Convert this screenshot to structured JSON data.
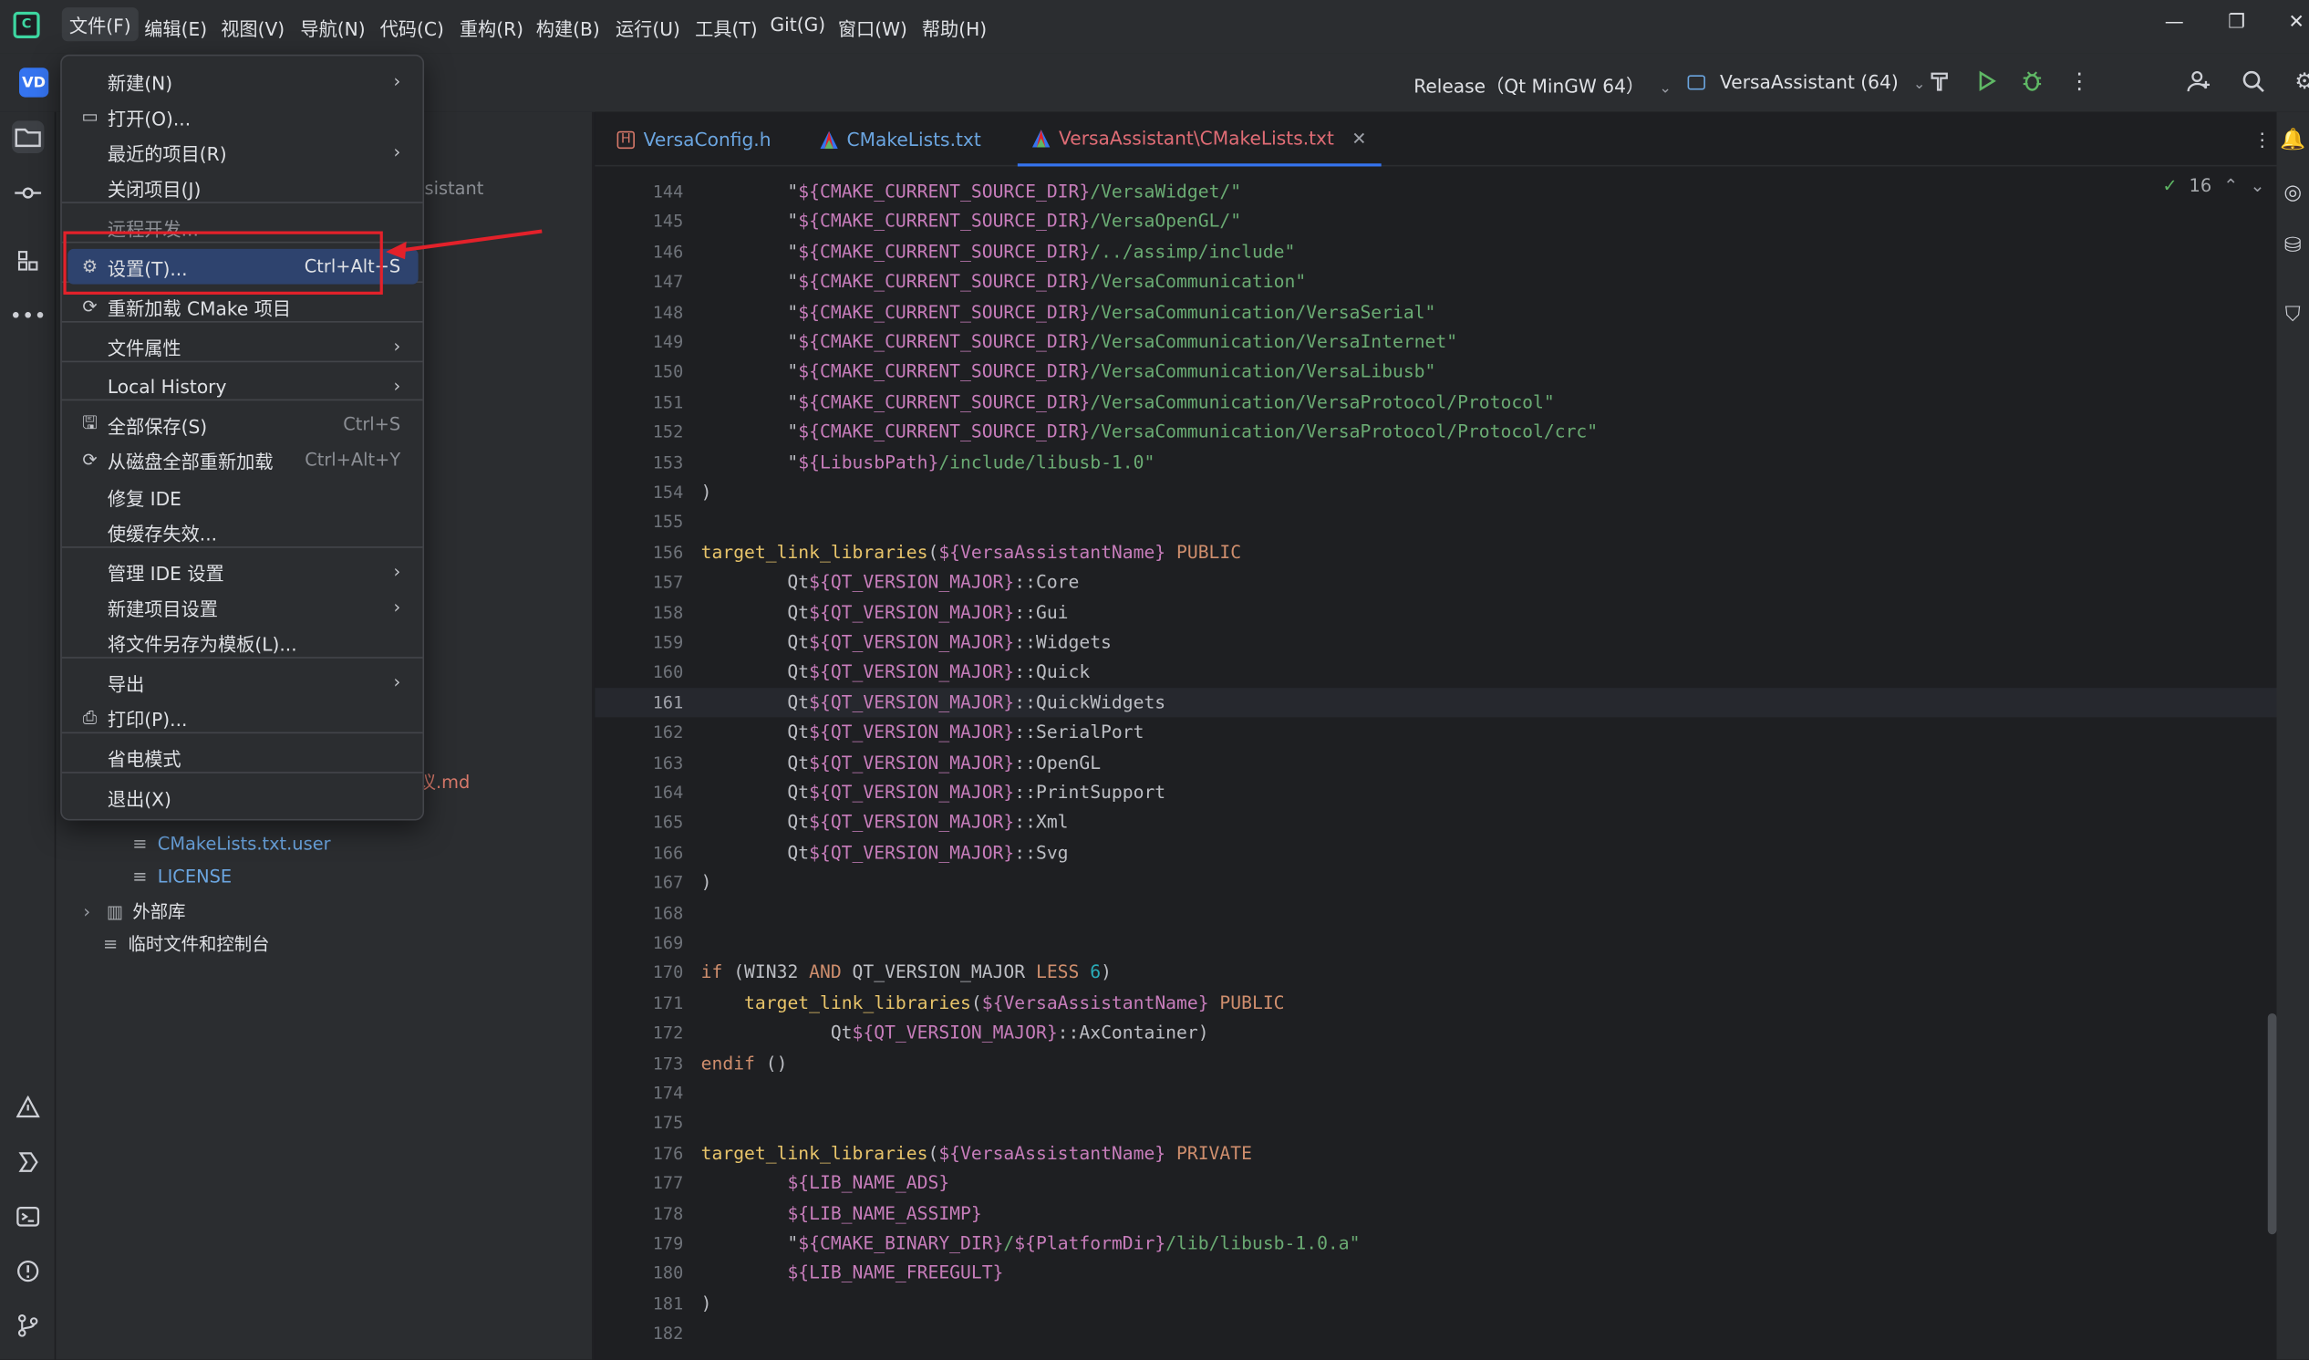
{
  "menubar": {
    "items": [
      "文件(F)",
      "编辑(E)",
      "视图(V)",
      "导航(N)",
      "代码(C)",
      "重构(R)",
      "构建(B)",
      "运行(U)",
      "工具(T)",
      "Git(G)",
      "窗口(W)",
      "帮助(H)"
    ]
  },
  "toolbar": {
    "project_badge": "VD",
    "run_config": "Release（Qt MinGW 64）",
    "target": "VersaAssistant (64)"
  },
  "file_menu": {
    "items": [
      {
        "label": "新建(N)",
        "shortcut": "",
        "submenu": true,
        "icon": ""
      },
      {
        "label": "打开(O)...",
        "shortcut": "",
        "submenu": false,
        "icon": "folder-icon"
      },
      {
        "label": "最近的项目(R)",
        "shortcut": "",
        "submenu": true,
        "icon": ""
      },
      {
        "label": "关闭项目(J)",
        "shortcut": "",
        "submenu": false,
        "icon": ""
      },
      {
        "label": "远程开发...",
        "shortcut": "",
        "submenu": false,
        "icon": ""
      },
      {
        "label": "设置(T)...",
        "shortcut": "Ctrl+Alt+S",
        "submenu": false,
        "icon": "gear-icon"
      },
      {
        "label": "重新加载 CMake 项目",
        "shortcut": "",
        "submenu": false,
        "icon": "reload-icon"
      },
      {
        "label": "文件属性",
        "shortcut": "",
        "submenu": true,
        "icon": ""
      },
      {
        "label": "Local History",
        "shortcut": "",
        "submenu": true,
        "icon": ""
      },
      {
        "label": "全部保存(S)",
        "shortcut": "Ctrl+S",
        "submenu": false,
        "icon": "save-icon"
      },
      {
        "label": "从磁盘全部重新加载",
        "shortcut": "Ctrl+Alt+Y",
        "submenu": false,
        "icon": "reload-icon"
      },
      {
        "label": "修复 IDE",
        "shortcut": "",
        "submenu": false,
        "icon": ""
      },
      {
        "label": "使缓存失效...",
        "shortcut": "",
        "submenu": false,
        "icon": ""
      },
      {
        "label": "管理 IDE 设置",
        "shortcut": "",
        "submenu": true,
        "icon": ""
      },
      {
        "label": "新建项目设置",
        "shortcut": "",
        "submenu": true,
        "icon": ""
      },
      {
        "label": "将文件另存为模板(L)...",
        "shortcut": "",
        "submenu": false,
        "icon": ""
      },
      {
        "label": "导出",
        "shortcut": "",
        "submenu": true,
        "icon": ""
      },
      {
        "label": "打印(P)...",
        "shortcut": "",
        "submenu": false,
        "icon": "print-icon"
      },
      {
        "label": "省电模式",
        "shortcut": "",
        "submenu": false,
        "icon": ""
      },
      {
        "label": "退出(X)",
        "shortcut": "",
        "submenu": false,
        "icon": ""
      }
    ]
  },
  "project_tree": {
    "partial_texts": [
      "ssistant",
      "议.md"
    ],
    "items": [
      {
        "label": "CMakeLists.txt.user",
        "kind": "file"
      },
      {
        "label": "LICENSE",
        "kind": "file"
      },
      {
        "label": "外部库",
        "kind": "folder"
      },
      {
        "label": "临时文件和控制台",
        "kind": "scratch"
      }
    ]
  },
  "tabs": [
    {
      "label": "VersaConfig.h",
      "icon": "header-file-icon",
      "active": false
    },
    {
      "label": "CMakeLists.txt",
      "icon": "cmake-icon",
      "active": false
    },
    {
      "label": "VersaAssistant\\CMakeLists.txt",
      "icon": "cmake-icon",
      "active": true
    }
  ],
  "inspection": {
    "count": "16"
  },
  "editor": {
    "current_line": 161,
    "lines": [
      {
        "n": 144,
        "tokens": [
          [
            "p",
            "        \""
          ],
          [
            "var",
            "${CMAKE_CURRENT_SOURCE_DIR}"
          ],
          [
            "str",
            "/VersaWidget/\""
          ]
        ]
      },
      {
        "n": 145,
        "tokens": [
          [
            "p",
            "        \""
          ],
          [
            "var",
            "${CMAKE_CURRENT_SOURCE_DIR}"
          ],
          [
            "str",
            "/VersaOpenGL/\""
          ]
        ]
      },
      {
        "n": 146,
        "tokens": [
          [
            "p",
            "        \""
          ],
          [
            "var",
            "${CMAKE_CURRENT_SOURCE_DIR}"
          ],
          [
            "str",
            "/../assimp/include\""
          ]
        ]
      },
      {
        "n": 147,
        "tokens": [
          [
            "p",
            "        \""
          ],
          [
            "var",
            "${CMAKE_CURRENT_SOURCE_DIR}"
          ],
          [
            "str",
            "/VersaCommunication\""
          ]
        ]
      },
      {
        "n": 148,
        "tokens": [
          [
            "p",
            "        \""
          ],
          [
            "var",
            "${CMAKE_CURRENT_SOURCE_DIR}"
          ],
          [
            "str",
            "/VersaCommunication/VersaSerial\""
          ]
        ]
      },
      {
        "n": 149,
        "tokens": [
          [
            "p",
            "        \""
          ],
          [
            "var",
            "${CMAKE_CURRENT_SOURCE_DIR}"
          ],
          [
            "str",
            "/VersaCommunication/VersaInternet\""
          ]
        ]
      },
      {
        "n": 150,
        "tokens": [
          [
            "p",
            "        \""
          ],
          [
            "var",
            "${CMAKE_CURRENT_SOURCE_DIR}"
          ],
          [
            "str",
            "/VersaCommunication/VersaLibusb\""
          ]
        ]
      },
      {
        "n": 151,
        "tokens": [
          [
            "p",
            "        \""
          ],
          [
            "var",
            "${CMAKE_CURRENT_SOURCE_DIR}"
          ],
          [
            "str",
            "/VersaCommunication/VersaProtocol/Protocol\""
          ]
        ]
      },
      {
        "n": 152,
        "tokens": [
          [
            "p",
            "        \""
          ],
          [
            "var",
            "${CMAKE_CURRENT_SOURCE_DIR}"
          ],
          [
            "str",
            "/VersaCommunication/VersaProtocol/Protocol/crc\""
          ]
        ]
      },
      {
        "n": 153,
        "tokens": [
          [
            "p",
            "        \""
          ],
          [
            "var",
            "${LibusbPath}"
          ],
          [
            "str",
            "/include/libusb-1.0\""
          ]
        ]
      },
      {
        "n": 154,
        "tokens": [
          [
            "p",
            ")"
          ]
        ]
      },
      {
        "n": 155,
        "tokens": []
      },
      {
        "n": 156,
        "tokens": [
          [
            "fn",
            "target_link_libraries"
          ],
          [
            "p",
            "("
          ],
          [
            "var",
            "${VersaAssistantName}"
          ],
          [
            "kw",
            " PUBLIC"
          ]
        ]
      },
      {
        "n": 157,
        "tokens": [
          [
            "p",
            "        Qt"
          ],
          [
            "var",
            "${QT_VERSION_MAJOR}"
          ],
          [
            "p",
            "::Core"
          ]
        ]
      },
      {
        "n": 158,
        "tokens": [
          [
            "p",
            "        Qt"
          ],
          [
            "var",
            "${QT_VERSION_MAJOR}"
          ],
          [
            "p",
            "::Gui"
          ]
        ]
      },
      {
        "n": 159,
        "tokens": [
          [
            "p",
            "        Qt"
          ],
          [
            "var",
            "${QT_VERSION_MAJOR}"
          ],
          [
            "p",
            "::Widgets"
          ]
        ]
      },
      {
        "n": 160,
        "tokens": [
          [
            "p",
            "        Qt"
          ],
          [
            "var",
            "${QT_VERSION_MAJOR}"
          ],
          [
            "p",
            "::Quick"
          ]
        ]
      },
      {
        "n": 161,
        "tokens": [
          [
            "p",
            "        Qt"
          ],
          [
            "var",
            "${QT_VERSION_MAJOR}"
          ],
          [
            "p",
            "::QuickWidgets"
          ]
        ]
      },
      {
        "n": 162,
        "tokens": [
          [
            "p",
            "        Qt"
          ],
          [
            "var",
            "${QT_VERSION_MAJOR}"
          ],
          [
            "p",
            "::SerialPort"
          ]
        ]
      },
      {
        "n": 163,
        "tokens": [
          [
            "p",
            "        Qt"
          ],
          [
            "var",
            "${QT_VERSION_MAJOR}"
          ],
          [
            "p",
            "::OpenGL"
          ]
        ]
      },
      {
        "n": 164,
        "tokens": [
          [
            "p",
            "        Qt"
          ],
          [
            "var",
            "${QT_VERSION_MAJOR}"
          ],
          [
            "p",
            "::PrintSupport"
          ]
        ]
      },
      {
        "n": 165,
        "tokens": [
          [
            "p",
            "        Qt"
          ],
          [
            "var",
            "${QT_VERSION_MAJOR}"
          ],
          [
            "p",
            "::Xml"
          ]
        ]
      },
      {
        "n": 166,
        "tokens": [
          [
            "p",
            "        Qt"
          ],
          [
            "var",
            "${QT_VERSION_MAJOR}"
          ],
          [
            "p",
            "::Svg"
          ]
        ]
      },
      {
        "n": 167,
        "tokens": [
          [
            "p",
            ")"
          ]
        ]
      },
      {
        "n": 168,
        "tokens": []
      },
      {
        "n": 169,
        "tokens": []
      },
      {
        "n": 170,
        "tokens": [
          [
            "kw",
            "if"
          ],
          [
            "p",
            " (WIN32 "
          ],
          [
            "kw",
            "AND"
          ],
          [
            "p",
            " QT_VERSION_MAJOR "
          ],
          [
            "kw",
            "LESS"
          ],
          [
            "num",
            " 6"
          ],
          [
            "p",
            ")"
          ]
        ]
      },
      {
        "n": 171,
        "tokens": [
          [
            "p",
            "    "
          ],
          [
            "fn",
            "target_link_libraries"
          ],
          [
            "p",
            "("
          ],
          [
            "var",
            "${VersaAssistantName}"
          ],
          [
            "kw",
            " PUBLIC"
          ]
        ]
      },
      {
        "n": 172,
        "tokens": [
          [
            "p",
            "            Qt"
          ],
          [
            "var",
            "${QT_VERSION_MAJOR}"
          ],
          [
            "p",
            "::AxContainer)"
          ]
        ]
      },
      {
        "n": 173,
        "tokens": [
          [
            "kw",
            "endif"
          ],
          [
            "p",
            " ()"
          ]
        ]
      },
      {
        "n": 174,
        "tokens": []
      },
      {
        "n": 175,
        "tokens": []
      },
      {
        "n": 176,
        "tokens": [
          [
            "fn",
            "target_link_libraries"
          ],
          [
            "p",
            "("
          ],
          [
            "var",
            "${VersaAssistantName}"
          ],
          [
            "kw",
            " PRIVATE"
          ]
        ]
      },
      {
        "n": 177,
        "tokens": [
          [
            "p",
            "        "
          ],
          [
            "var",
            "${LIB_NAME_ADS}"
          ]
        ]
      },
      {
        "n": 178,
        "tokens": [
          [
            "p",
            "        "
          ],
          [
            "var",
            "${LIB_NAME_ASSIMP}"
          ]
        ]
      },
      {
        "n": 179,
        "tokens": [
          [
            "p",
            "        \""
          ],
          [
            "var",
            "${CMAKE_BINARY_DIR}"
          ],
          [
            "str",
            "/"
          ],
          [
            "var",
            "${PlatformDir}"
          ],
          [
            "str",
            "/lib/libusb-1.0.a\""
          ]
        ]
      },
      {
        "n": 180,
        "tokens": [
          [
            "p",
            "        "
          ],
          [
            "var",
            "${LIB_NAME_FREEGULT}"
          ]
        ]
      },
      {
        "n": 181,
        "tokens": [
          [
            "p",
            ")"
          ]
        ]
      },
      {
        "n": 182,
        "tokens": []
      }
    ]
  },
  "colors": {
    "accent": "#3574f0",
    "annotation": "#e3212a",
    "selection": "#2e436e"
  }
}
